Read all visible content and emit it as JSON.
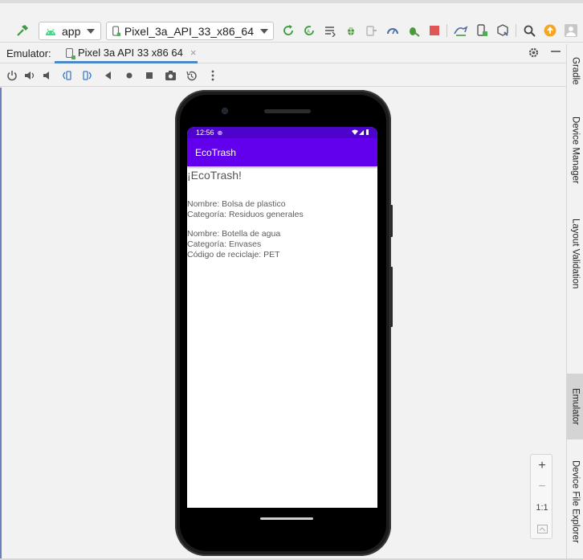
{
  "toolbar": {
    "module": "app",
    "device": "Pixel_3a_API_33_x86_64"
  },
  "emulator_tabs": {
    "label": "Emulator:",
    "active_tab": "Pixel 3a API 33 x86 64",
    "close_glyph": "×"
  },
  "phone": {
    "status_time": "12:56",
    "app_title": "EcoTrash",
    "heading": "¡EcoTrash!",
    "items": [
      {
        "nombre": "Nombre: Bolsa de plastico",
        "categoria": "Categoría: Residuos generales"
      },
      {
        "nombre": "Nombre: Botella de agua",
        "categoria": "Categoría: Envases",
        "codigo": "Código de reciclaje: PET"
      }
    ]
  },
  "side_tabs": {
    "gradle": "Gradle",
    "device_manager": "Device Manager",
    "layout_validation": "Layout Validation",
    "emulator": "Emulator",
    "device_file_explorer": "Device File Explorer"
  },
  "zoom": {
    "zoom_in": "+",
    "zoom_out": "−",
    "actual_size": "1:1"
  },
  "colors": {
    "status_bar": "#4d03c9",
    "app_bar": "#6200ee",
    "tab_underline": "#4a88c7",
    "run_green": "#4caf50",
    "stop_red": "#e05555",
    "update_orange": "#f5a623"
  }
}
